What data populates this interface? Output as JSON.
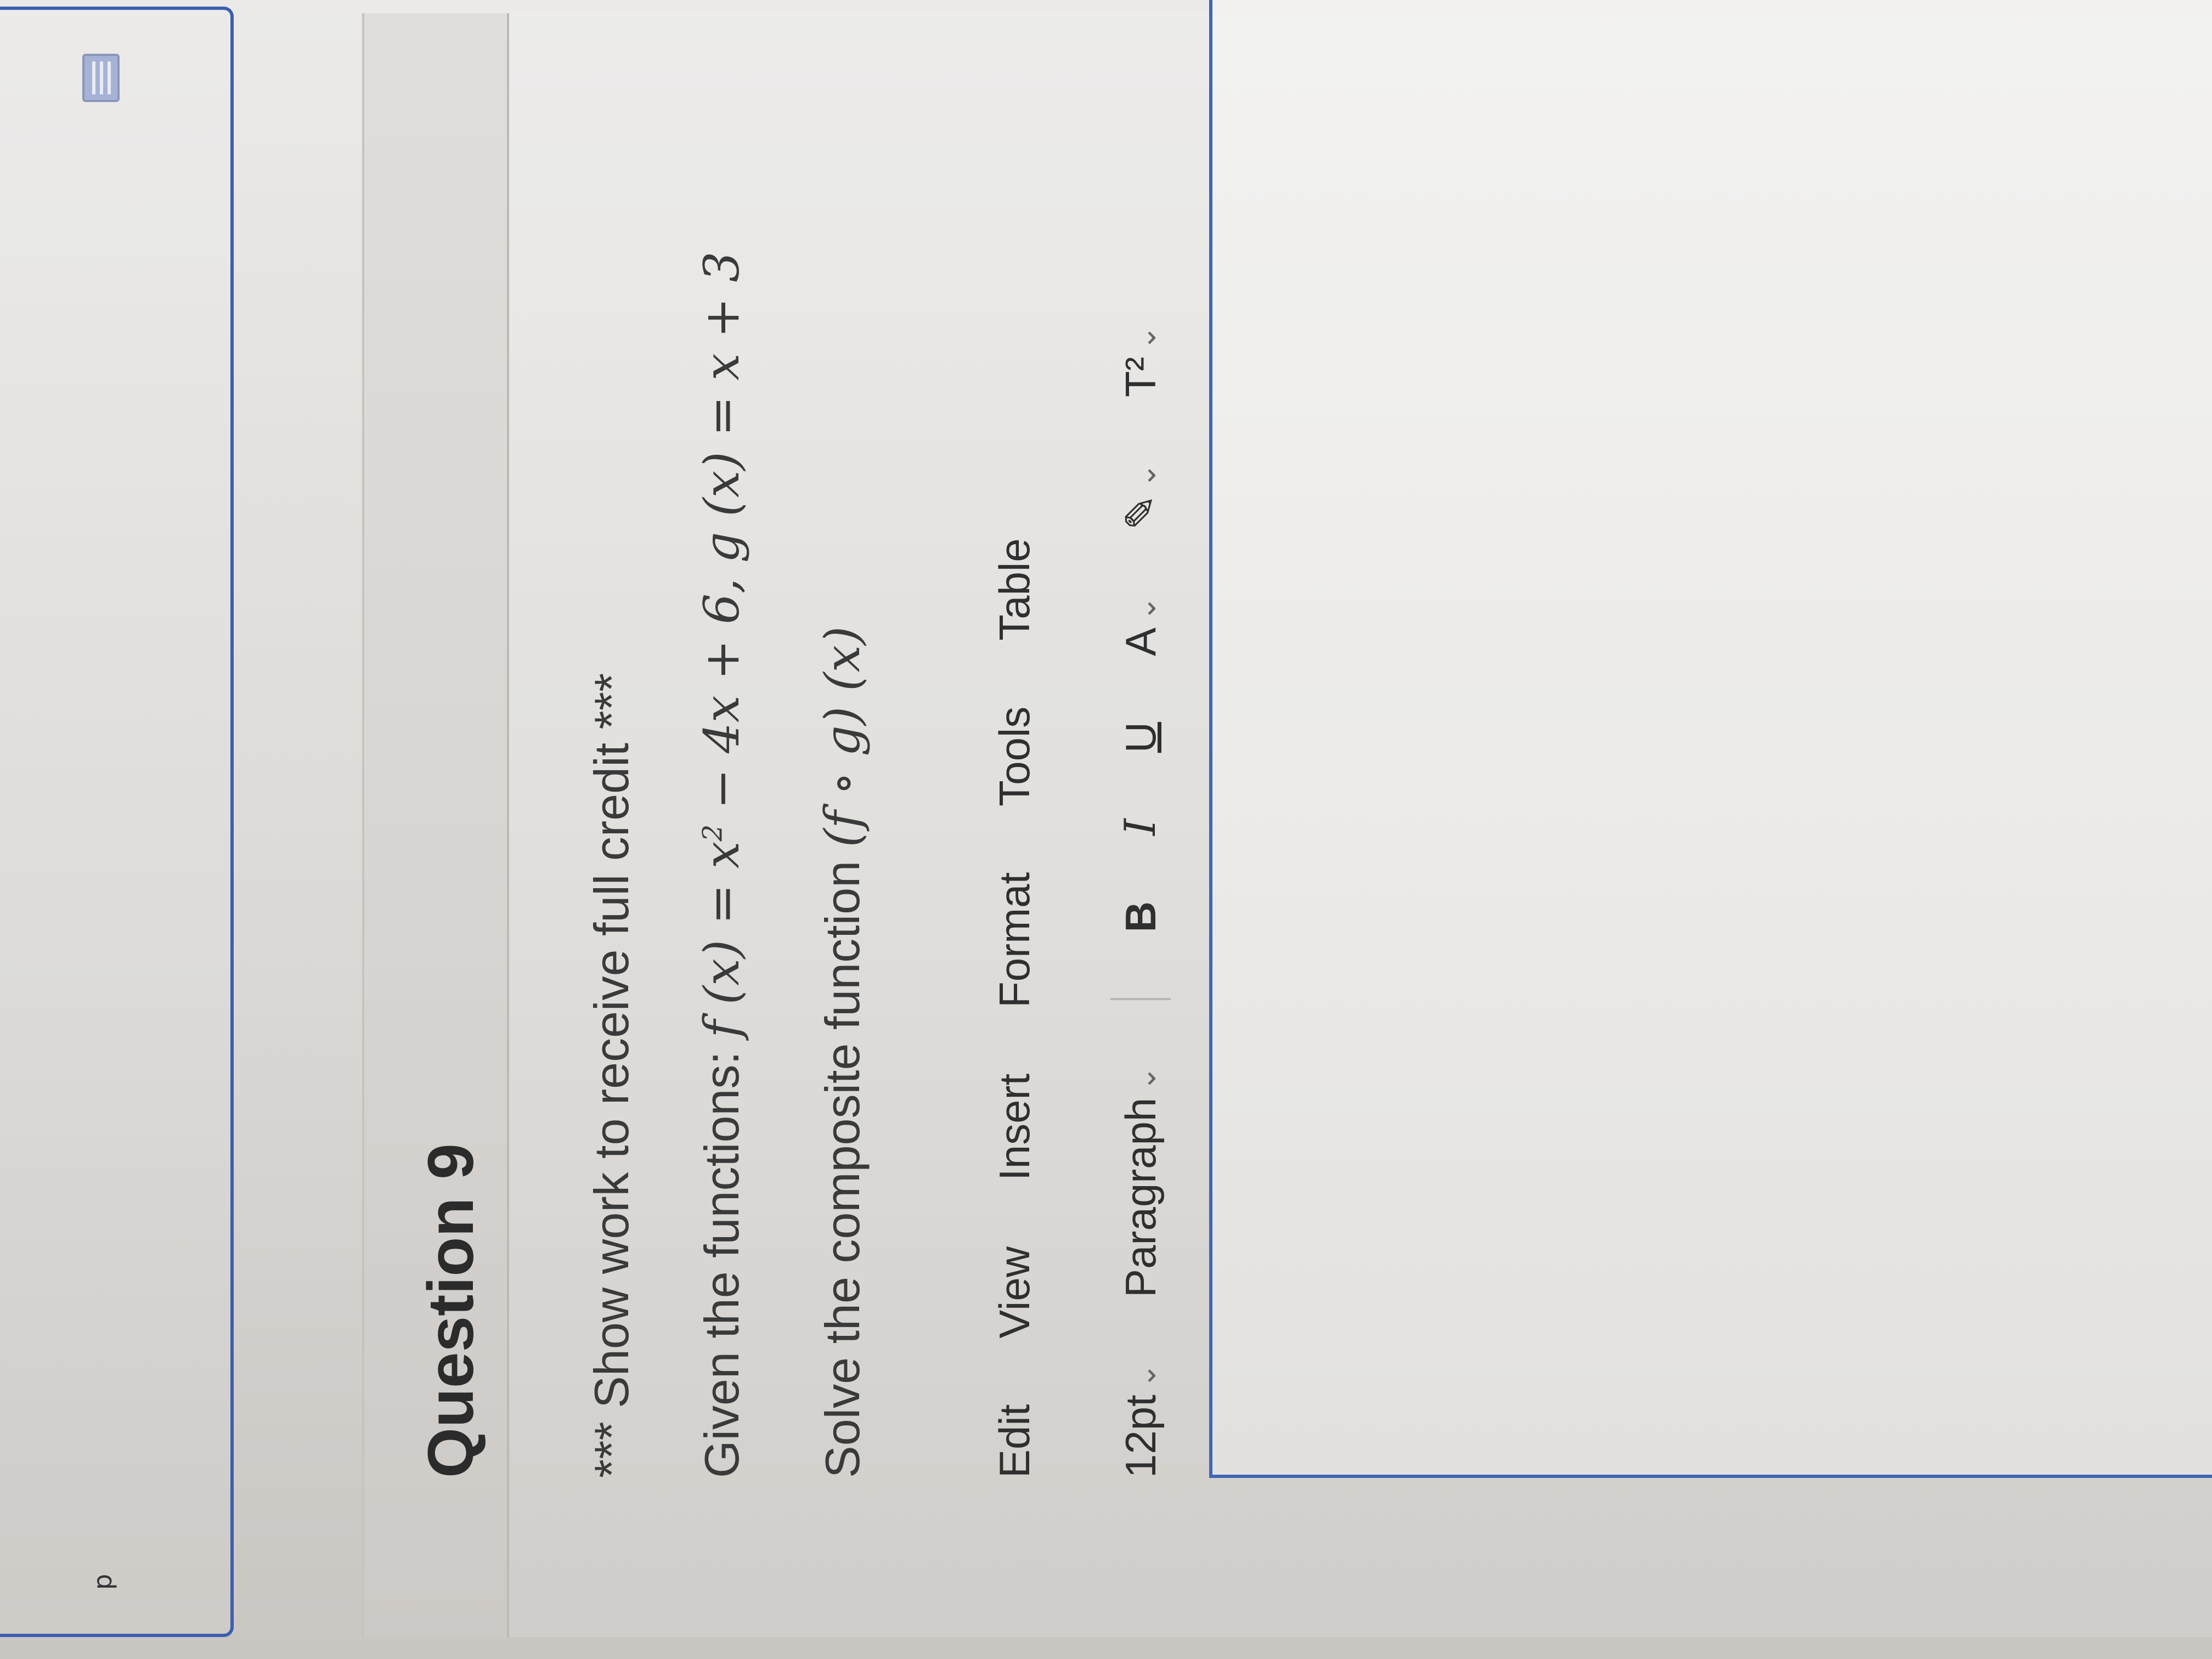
{
  "previous_question": {
    "letter": "p"
  },
  "question": {
    "title": "Question 9",
    "note": "*** Show work to receive full credit ***",
    "given_prefix": "Given the functions: ",
    "given_f": "f (x) = x",
    "given_f_exp": "2",
    "given_rest": " − 4x + 6,  g (x) = x + 3",
    "solve_prefix": "Solve the composite function ",
    "solve_expr": "(f ∘ g) (x)"
  },
  "editor": {
    "menu": [
      "Edit",
      "View",
      "Insert",
      "Format",
      "Tools",
      "Table"
    ],
    "font_size": "12pt",
    "block_format": "Paragraph",
    "bold_label": "B",
    "italic_label": "I",
    "underline_label": "U",
    "text_color_label": "A",
    "highlight_label": "✎",
    "superscript_label": "T²",
    "chevron": "⌄"
  }
}
